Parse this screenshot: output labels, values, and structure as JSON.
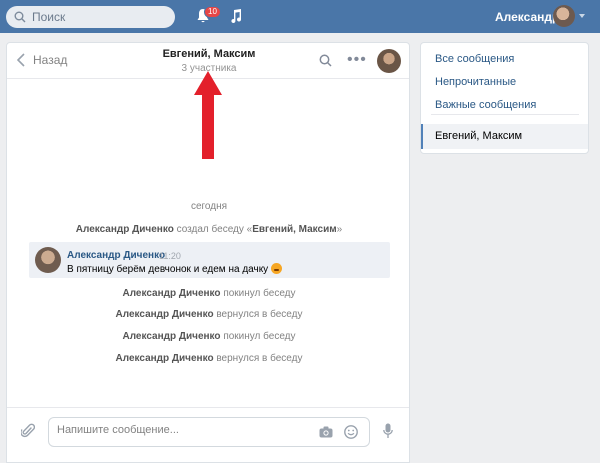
{
  "topbar": {
    "search_placeholder": "Поиск",
    "notifications_badge": "10",
    "user_name": "Александр"
  },
  "chat": {
    "back_label": "Назад",
    "title": "Евгений, Максим",
    "subtitle": "3 участника",
    "date_divider": "сегодня",
    "system_events": [
      {
        "author": "Александр Диченко",
        "action_pre": "создал беседу «",
        "target": "Евгений, Максим",
        "action_post": "»"
      },
      {
        "author": "Александр Диченко",
        "action": "покинул беседу"
      },
      {
        "author": "Александр Диченко",
        "action": "вернулся в беседу"
      },
      {
        "author": "Александр Диченко",
        "action": "покинул беседу"
      },
      {
        "author": "Александр Диченко",
        "action": "вернулся в беседу"
      }
    ],
    "message": {
      "author": "Александр Диченко",
      "time": "11:20",
      "text": "В пятницу берём девчонок и едем на дачку"
    },
    "composer_placeholder": "Напишите сообщение..."
  },
  "menu": {
    "items": [
      "Все сообщения",
      "Непрочитанные",
      "Важные сообщения"
    ],
    "active_item": "Евгений, Максим"
  },
  "colors": {
    "topbar": "#4a76a8",
    "link": "#2a5885",
    "badge": "#e64646",
    "annotation_arrow": "#e3202b"
  },
  "icons": [
    "search-icon",
    "bell-icon",
    "music-icon",
    "back-arrow-icon",
    "more-icon",
    "paperclip-icon",
    "camera-icon",
    "smile-icon",
    "microphone-icon"
  ]
}
